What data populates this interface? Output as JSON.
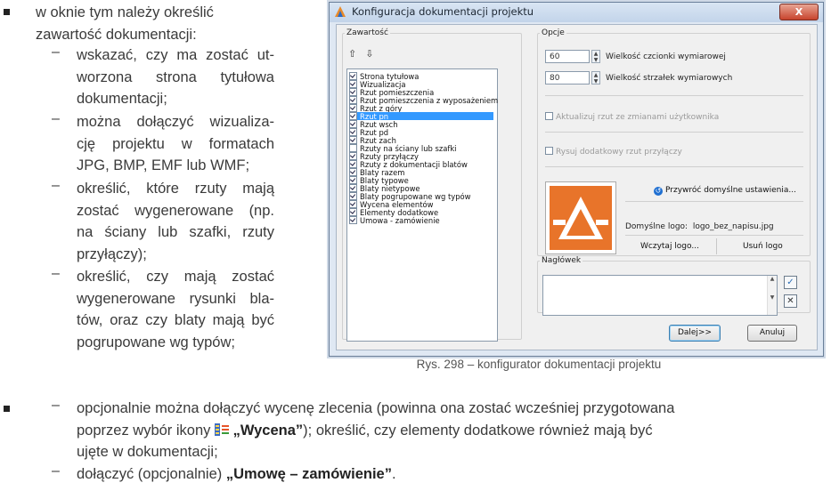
{
  "document": {
    "bullet1_lines": [
      "w oknie tym należy określić",
      "zawartość dokumentacji:"
    ],
    "items": [
      {
        "lines": [
          "wskazać, czy ma zostać ut-",
          "worzona strona tytułowa",
          "dokumentacji;"
        ]
      },
      {
        "lines": [
          "można dołączyć wizualiza-",
          "cję projektu w formatach",
          "JPG, BMP, EMF lub WMF;"
        ]
      },
      {
        "lines": [
          "określić, które rzuty mają",
          "zostać wygenerowane (np.",
          "na ściany lub szafki, rzuty",
          "przyłączy);"
        ]
      },
      {
        "lines": [
          "określić, czy mają zostać",
          "wygenerowane rysunki bla-",
          "tów, oraz czy blaty mają być",
          "pogrupowane wg typów;"
        ]
      }
    ],
    "item5": {
      "line1": "opcjonalnie można dołączyć wycenę zlecenia (powinna ona zostać wcześniej przygotowana",
      "line2_before": "poprzez wybór ikony ",
      "line2_bold": "„Wycena”",
      "line2_after": "); określić, czy elementy dodatkowe również mają być",
      "line3": "ujęte w dokumentacji;"
    },
    "item6": {
      "before": "dołączyć (opcjonalnie) ",
      "bold": "„Umowę – zamówienie”",
      "after": "."
    },
    "caption": "Rys. 298 – konfigurator dokumentacji projektu"
  },
  "dialog": {
    "title": "Konfiguracja dokumentacji projektu",
    "close_label": "X",
    "content_group": "Zawartość",
    "options_group": "Opcje",
    "header_group": "Nagłówek",
    "list": [
      {
        "label": "Strona tytułowa",
        "checked": true
      },
      {
        "label": "Wizualizacja",
        "checked": true
      },
      {
        "label": "Rzut pomieszczenia",
        "checked": true
      },
      {
        "label": "Rzut pomieszczenia z wyposażeniem",
        "checked": true
      },
      {
        "label": "Rzut z góry",
        "checked": true
      },
      {
        "label": "Rzut pn",
        "checked": true,
        "selected": true
      },
      {
        "label": "Rzut wsch",
        "checked": true
      },
      {
        "label": "Rzut pd",
        "checked": true
      },
      {
        "label": "Rzut zach",
        "checked": true
      },
      {
        "label": "Rzuty na ściany lub szafki",
        "checked": false
      },
      {
        "label": "Rzuty przyłączy",
        "checked": true
      },
      {
        "label": "Rzuty z dokumentacji blatów",
        "checked": true
      },
      {
        "label": "Blaty razem",
        "checked": true
      },
      {
        "label": "Blaty typowe",
        "checked": true
      },
      {
        "label": "Blaty nietypowe",
        "checked": true
      },
      {
        "label": "Blaty pogrupowane wg typów",
        "checked": true
      },
      {
        "label": "Wycena elementów",
        "checked": true
      },
      {
        "label": "Elementy dodatkowe",
        "checked": true
      },
      {
        "label": "Umowa - zamówienie",
        "checked": true
      }
    ],
    "font_size_value": "60",
    "font_size_label": "Wielkość czcionki wymiarowej",
    "arrow_size_value": "80",
    "arrow_size_label": "Wielkość strzałek wymiarowych",
    "update_view_label": "Aktualizuj rzut ze zmianami użytkownika",
    "extra_view_label": "Rysuj dodatkowy rzut przyłączy",
    "restore_label": "Przywróć domyślne ustawienia...",
    "default_logo_label": "Domyślne logo:",
    "default_logo_value": "logo_bez_napisu.jpg",
    "load_logo_label": "Wczytaj logo...",
    "remove_logo_label": "Usuń logo",
    "next_label": "Dalej>>",
    "cancel_label": "Anuluj",
    "colors": {
      "accent": "#3399ff",
      "logo": "#e8742a"
    }
  }
}
